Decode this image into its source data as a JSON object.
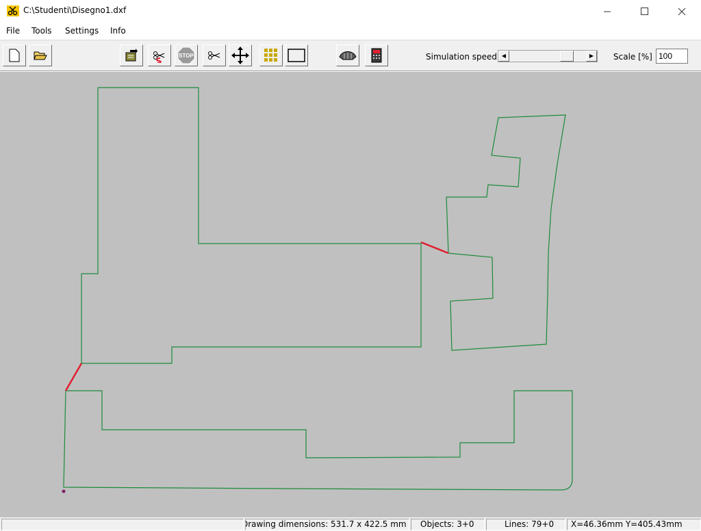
{
  "window": {
    "title": "C:\\Studenti\\Disegno1.dxf",
    "icon": "scissors-app-icon",
    "minimize": "—",
    "maximize": "☐",
    "close": "✕"
  },
  "menu": {
    "items": [
      "File",
      "Tools",
      "Settings",
      "Info"
    ]
  },
  "toolbar": {
    "buttons": [
      "new-file",
      "open-file",
      "import",
      "cut-path",
      "stop",
      "cut",
      "move",
      "grid",
      "rectangle",
      "machine",
      "calculator"
    ],
    "simulation_speed_label": "Simulation speed",
    "simulation_speed_value": 0.8,
    "scale_label": "Scale [%]",
    "scale_value": "100"
  },
  "colors": {
    "canvas": "#c0c0c0",
    "path": "#1c8a3a",
    "rapid": "#e02030",
    "start_point": "#7a1f6b"
  },
  "status": {
    "panel0": "",
    "dimensions": "Drawing dimensions: 531.7 x 422.5 mm",
    "objects": "Objects: 3+0",
    "lines": "Lines: 79+0",
    "coords": "X=46.36mm Y=405.43mm"
  }
}
